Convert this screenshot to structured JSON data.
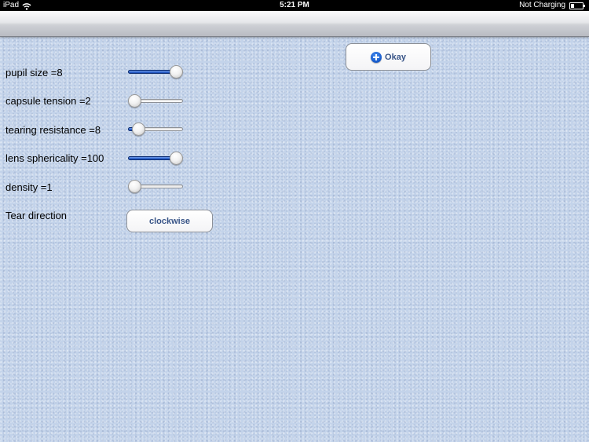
{
  "status_bar": {
    "device": "iPad",
    "time": "5:21 PM",
    "battery_status": "Not Charging",
    "icons": [
      "wifi-icon",
      "battery-icon"
    ]
  },
  "actions": {
    "okay_label": "Okay",
    "okay_icon": "plus-circle-icon"
  },
  "settings": [
    {
      "label": "pupil size =8",
      "level": 1.0
    },
    {
      "label": "capsule tension =2",
      "level": 0.0
    },
    {
      "label": "tearing resistance =8",
      "level": 0.1
    },
    {
      "label": "lens sphericality =100",
      "level": 1.0
    },
    {
      "label": "density =1",
      "level": 0.0
    }
  ],
  "tear_direction": {
    "label": "Tear direction",
    "value": "clockwise"
  },
  "colors": {
    "background": "#c3d3ea",
    "slider_fill": "#1247b8",
    "button_text": "#385487"
  }
}
